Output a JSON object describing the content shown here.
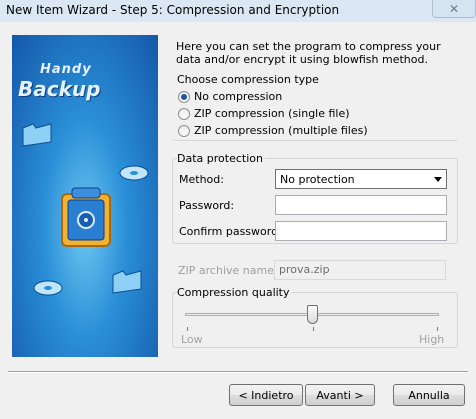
{
  "window": {
    "title": "New Item Wizard - Step 5: Compression and Encryption",
    "close_glyph": "✕"
  },
  "sidebar": {
    "logo_top": "Handy",
    "logo_bottom": "Backup",
    "icons": [
      "folder-icon",
      "disc-icon",
      "safe-icon"
    ]
  },
  "intro_text": "Here you can set the program to compress your data and/or encrypt it using blowfish method.",
  "compression": {
    "group_label": "Choose compression type",
    "options": [
      {
        "label": "No compression",
        "checked": true
      },
      {
        "label": "ZIP compression (single file)",
        "checked": false
      },
      {
        "label": "ZIP compression (multiple files)",
        "checked": false
      }
    ]
  },
  "protection": {
    "group_label": "Data protection",
    "method_label": "Method:",
    "method_value": "No protection",
    "password_label": "Password:",
    "confirm_label": "Confirm password:",
    "password_value": "",
    "confirm_value": ""
  },
  "zip": {
    "label": "ZIP archive name:",
    "value": "prova.zip"
  },
  "quality": {
    "group_label": "Compression quality",
    "low_label": "Low",
    "high_label": "High",
    "level_fraction": 0.5
  },
  "buttons": {
    "back": "< Indietro",
    "next": "Avanti >",
    "cancel": "Annulla"
  },
  "colors": {
    "accent": "#1e56a8",
    "sidebar_dark": "#1457a8",
    "sidebar_light": "#6fc7f1"
  }
}
